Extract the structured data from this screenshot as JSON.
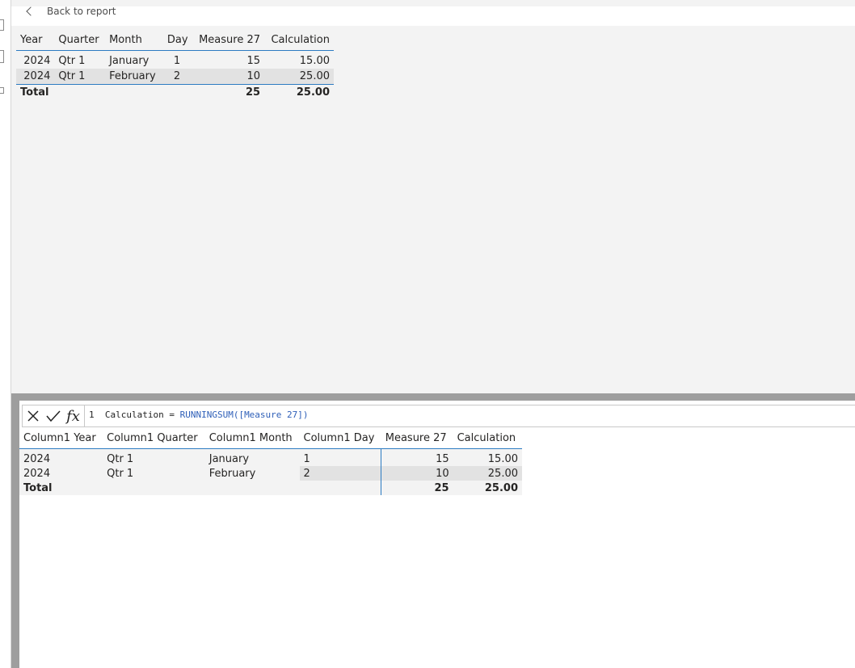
{
  "report": {
    "back_label": "Back to report",
    "table": {
      "columns": [
        "Year",
        "Quarter",
        "Month",
        "Day",
        "Measure 27",
        "Calculation"
      ],
      "rows": [
        [
          "2024",
          "Qtr 1",
          "January",
          "1",
          "15",
          "15.00"
        ],
        [
          "2024",
          "Qtr 1",
          "February",
          "2",
          "10",
          "25.00"
        ]
      ],
      "total": {
        "label": "Total",
        "measure": "25",
        "calculation": "25.00"
      }
    }
  },
  "formula": {
    "line_number": "1",
    "prefix": "Calculation = ",
    "function": "RUNNINGSUM([Measure 27])",
    "cancel_icon": "close-icon",
    "commit_icon": "check-icon",
    "fx_label": "fx"
  },
  "grid": {
    "columns": [
      "Column1 Year",
      "Column1 Quarter",
      "Column1 Month",
      "Column1 Day",
      "Measure 27",
      "Calculation"
    ],
    "rows": [
      [
        "2024",
        "Qtr 1",
        "January",
        "1",
        "15",
        "15.00"
      ],
      [
        "2024",
        "Qtr 1",
        "February",
        "2",
        "10",
        "25.00"
      ]
    ],
    "total": {
      "label": "Total",
      "measure": "25",
      "calculation": "25.00"
    }
  },
  "colors": {
    "accent": "#2c7bc2",
    "canvas": "#f3f3f3",
    "splitter": "#9e9e9e"
  }
}
